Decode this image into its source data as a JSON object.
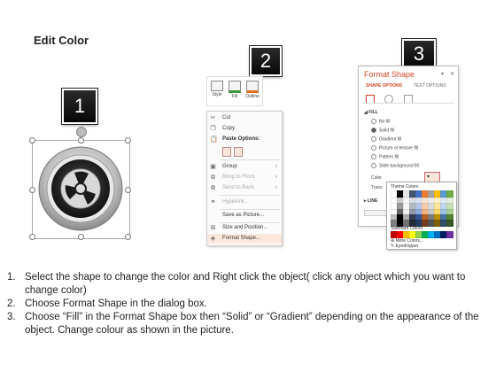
{
  "title": "Edit Color",
  "steps": {
    "badge1": "1",
    "badge2": "2",
    "badge3": "3"
  },
  "ribbon": {
    "style_label": "Style",
    "fill_label": "Fill",
    "outline_label": "Outline"
  },
  "context_menu": {
    "items": [
      {
        "icon": "cut-icon",
        "label": "Cut",
        "disabled": false,
        "submenu": false
      },
      {
        "icon": "copy-icon",
        "label": "Copy",
        "disabled": false,
        "submenu": false
      },
      {
        "icon": "paste-icon",
        "label": "Paste Options:",
        "disabled": false,
        "submenu": false
      },
      {
        "icon": "group-icon",
        "label": "Group",
        "disabled": false,
        "submenu": true
      },
      {
        "icon": "bring-front-icon",
        "label": "Bring to Front",
        "disabled": true,
        "submenu": true
      },
      {
        "icon": "send-back-icon",
        "label": "Send to Back",
        "disabled": true,
        "submenu": true
      },
      {
        "icon": "hyperlink-icon",
        "label": "Hyperlink...",
        "disabled": true,
        "submenu": false
      },
      {
        "icon": "save-picture-icon",
        "label": "Save as Picture...",
        "disabled": false,
        "submenu": false
      },
      {
        "icon": "size-position-icon",
        "label": "Size and Position...",
        "disabled": false,
        "submenu": false
      },
      {
        "icon": "format-shape-icon",
        "label": "Format Shape...",
        "disabled": false,
        "submenu": false,
        "highlighted": true
      }
    ]
  },
  "format_pane": {
    "title": "Format Shape",
    "tab_shape": "SHAPE OPTIONS",
    "tab_text": "TEXT OPTIONS",
    "fill_section": "FILL",
    "fill_options": [
      "No fill",
      "Solid fill",
      "Gradient fill",
      "Picture or texture fill",
      "Pattern fill",
      "Slide background fill"
    ],
    "selected_fill": "Solid fill",
    "color_label": "Color",
    "transparency_label": "Trans",
    "line_section": "LINE"
  },
  "palette": {
    "theme_label": "Theme Colors",
    "standard_label": "Standard Colors",
    "more_colors": "More Colors...",
    "eyedropper": "Eyedropper",
    "theme_base": [
      "#ffffff",
      "#000000",
      "#e7e6e6",
      "#44546a",
      "#4472c4",
      "#ed7d31",
      "#a5a5a5",
      "#ffc000",
      "#5b9bd5",
      "#70ad47"
    ],
    "standard": [
      "#c00000",
      "#ff0000",
      "#ffc000",
      "#ffff00",
      "#92d050",
      "#00b050",
      "#00b0f0",
      "#0070c0",
      "#002060",
      "#7030a0"
    ]
  },
  "instructions": [
    {
      "num": "1.",
      "text": "Select the shape to change the color and Right click the object( click any object which you want to change color)"
    },
    {
      "num": "2.",
      "text": "Choose Format Shape in the dialog box."
    },
    {
      "num": "3.",
      "text": "Choose “Fill” in the Format Shape box then “Solid” or “Gradient” depending on the appearance of the object. Change colour as shown in the picture."
    }
  ]
}
